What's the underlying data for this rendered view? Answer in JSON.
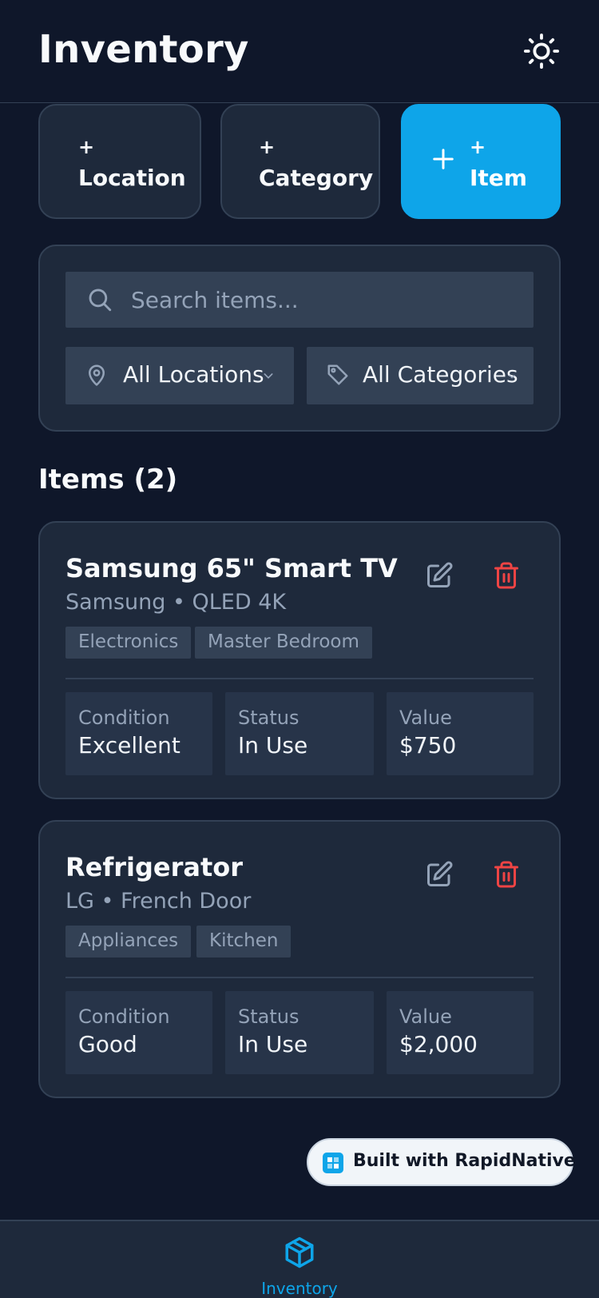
{
  "header": {
    "title": "Inventory",
    "theme_icon": "sun-icon"
  },
  "actions": {
    "plus": "+",
    "location_label": "Location",
    "category_label": "Category",
    "item_label": "Item"
  },
  "filters": {
    "search_placeholder": "Search items...",
    "location_value": "All Locations",
    "category_value": "All Categories"
  },
  "items_heading": "Items (2)",
  "items": [
    {
      "name": "Samsung 65\" Smart TV",
      "subtitle": "Samsung • QLED 4K",
      "tags": [
        "Electronics",
        "Master Bedroom"
      ],
      "condition_label": "Condition",
      "condition": "Excellent",
      "status_label": "Status",
      "status": "In Use",
      "value_label": "Value",
      "value": "$750"
    },
    {
      "name": "Refrigerator",
      "subtitle": "LG • French Door",
      "tags": [
        "Appliances",
        "Kitchen"
      ],
      "condition_label": "Condition",
      "condition": "Good",
      "status_label": "Status",
      "status": "In Use",
      "value_label": "Value",
      "value": "$2,000"
    }
  ],
  "badge": {
    "text": "Built with RapidNative"
  },
  "nav": {
    "label": "Inventory"
  },
  "colors": {
    "background": "#0f172a",
    "card": "#1e293b",
    "accent": "#0ea5e9",
    "danger": "#ef4444"
  }
}
